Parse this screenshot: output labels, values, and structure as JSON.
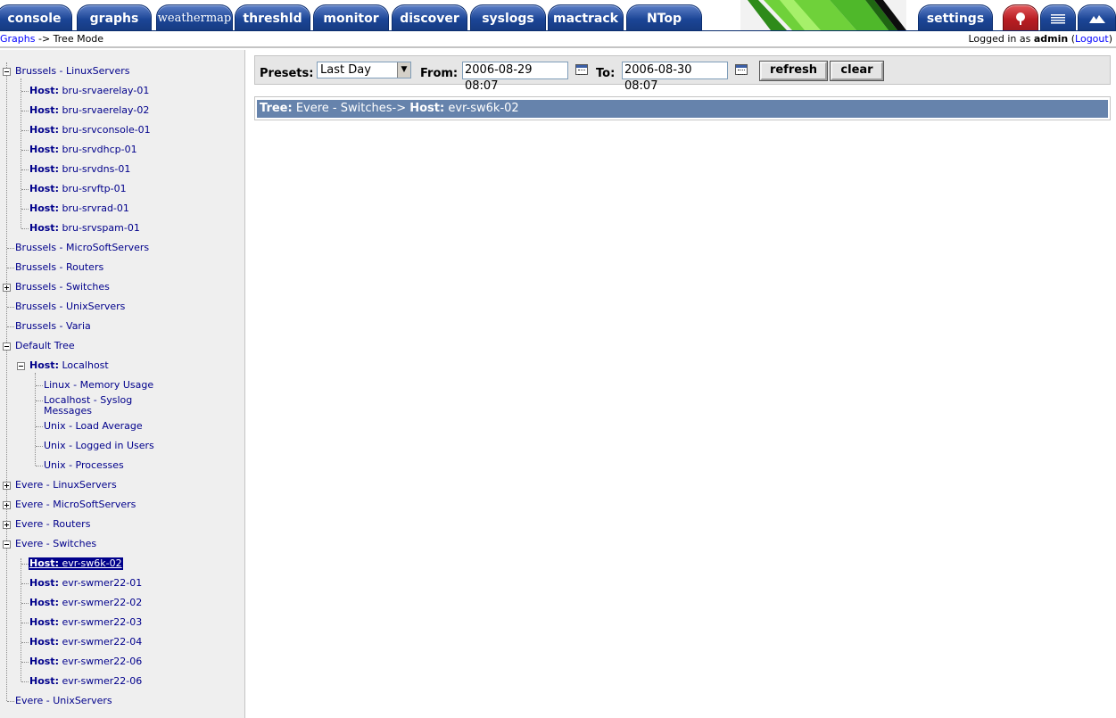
{
  "tabs": [
    {
      "label": "console"
    },
    {
      "label": "graphs"
    },
    {
      "label": "weathermap"
    },
    {
      "label": "threshld"
    },
    {
      "label": "monitor"
    },
    {
      "label": "discover"
    },
    {
      "label": "syslogs"
    },
    {
      "label": "mactrack"
    },
    {
      "label": "NTop"
    },
    {
      "label": "settings"
    }
  ],
  "header_icons": [
    "tree-view-icon",
    "list-view-icon",
    "preview-icon"
  ],
  "breadcrumb": {
    "link": "Graphs",
    "separator": " -> ",
    "current": "Tree Mode"
  },
  "login": {
    "prefix": "Logged in as ",
    "user": "admin",
    "open": " (",
    "logout": "Logout",
    "close": ")"
  },
  "tree": {
    "host_prefix": "Host:",
    "nodes": [
      {
        "label": "Brussels - LinuxServers"
      },
      {
        "host": "bru-srvaerelay-01"
      },
      {
        "host": "bru-srvaerelay-02"
      },
      {
        "host": "bru-srvconsole-01"
      },
      {
        "host": "bru-srvdhcp-01"
      },
      {
        "host": "bru-srvdns-01"
      },
      {
        "host": "bru-srvftp-01"
      },
      {
        "host": "bru-srvrad-01"
      },
      {
        "host": "bru-srvspam-01"
      },
      {
        "label": "Brussels - MicroSoftServers"
      },
      {
        "label": "Brussels - Routers"
      },
      {
        "label": "Brussels - Switches"
      },
      {
        "label": "Brussels - UnixServers"
      },
      {
        "label": "Brussels - Varia"
      },
      {
        "label": "Default Tree"
      },
      {
        "host": "Localhost"
      },
      {
        "label": "Linux - Memory Usage"
      },
      {
        "label": "Localhost - Syslog Messages"
      },
      {
        "label": "Unix - Load Average"
      },
      {
        "label": "Unix - Logged in Users"
      },
      {
        "label": "Unix - Processes"
      },
      {
        "label": "Evere - LinuxServers"
      },
      {
        "label": "Evere - MicroSoftServers"
      },
      {
        "label": "Evere - Routers"
      },
      {
        "label": "Evere - Switches"
      },
      {
        "host": "evr-sw6k-02",
        "selected": true
      },
      {
        "host": "evr-swmer22-01"
      },
      {
        "host": "evr-swmer22-02"
      },
      {
        "host": "evr-swmer22-03"
      },
      {
        "host": "evr-swmer22-04"
      },
      {
        "host": "evr-swmer22-06"
      },
      {
        "host": "evr-swmer22-06"
      },
      {
        "label": "Evere - UnixServers"
      }
    ]
  },
  "filter": {
    "presets_label": "Presets:",
    "preset_value": "Last Day",
    "from_label": "From:",
    "from_value": "2006-08-29 08:07",
    "to_label": "To:",
    "to_value": "2006-08-30 08:07",
    "refresh_label": "refresh",
    "clear_label": "clear"
  },
  "tree_header": {
    "tree_label": "Tree:",
    "tree_value": "Evere - Switches->",
    "host_label": "Host:",
    "host_value": "evr-sw6k-02"
  },
  "colors": {
    "tab_blue": "#1b4596",
    "tab_red": "#b81d22",
    "link": "#00008b",
    "bar": "#6683ac"
  }
}
